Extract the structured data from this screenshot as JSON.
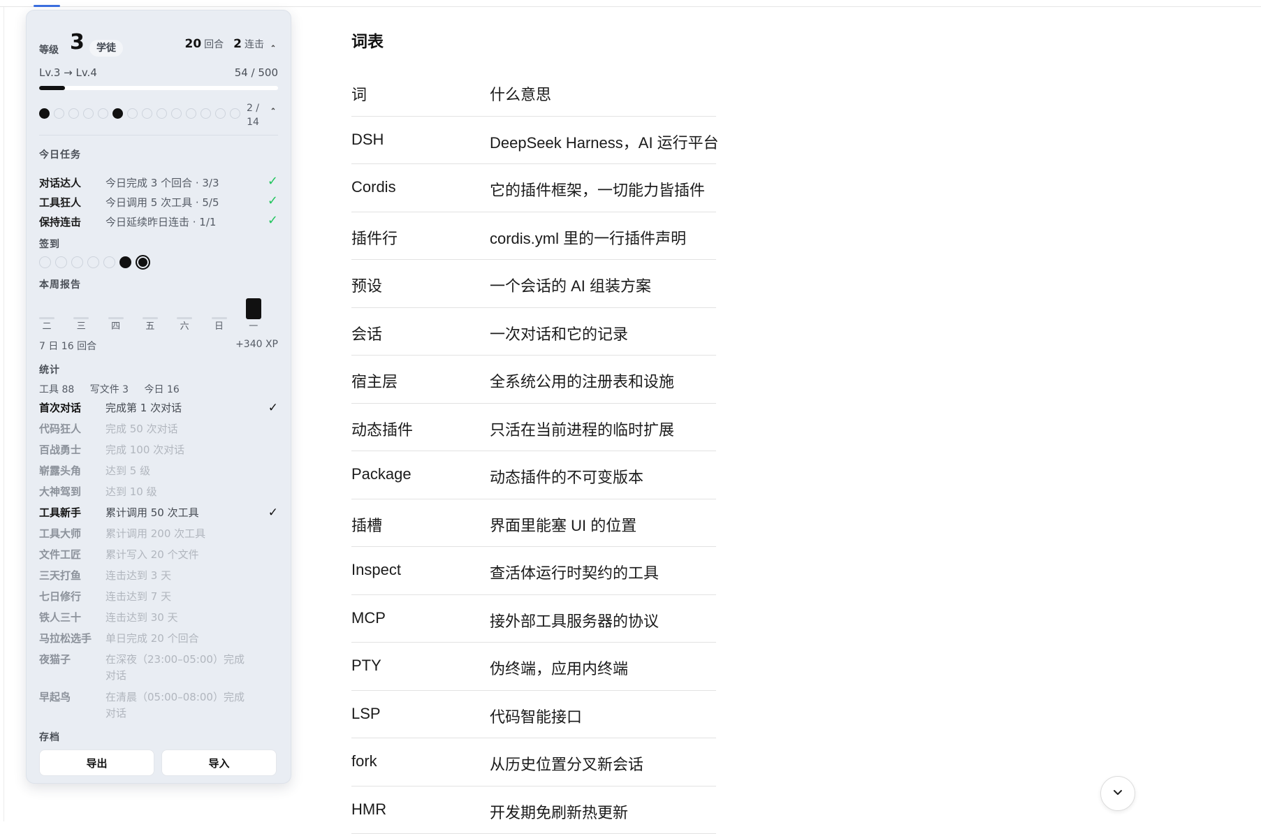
{
  "panel": {
    "level_label": "等级",
    "level": "3",
    "rank": "学徒",
    "rounds_count": "20",
    "rounds_label": "回合",
    "streak_count": "2",
    "streak_label": "连击",
    "xp_range": "Lv.3 → Lv.4",
    "xp_value": "54 / 500",
    "xp_fraction": 0.108,
    "dots_count": "2 /\n14",
    "dots_total": 14,
    "dots_on": [
      0,
      5
    ],
    "tasks_title": "今日任务",
    "tasks": [
      {
        "name": "对话达人",
        "desc": "今日完成 3 个回合 · 3/3",
        "done": true
      },
      {
        "name": "工具狂人",
        "desc": "今日调用 5 次工具 · 5/5",
        "done": true
      },
      {
        "name": "保持连击",
        "desc": "今日延续昨日连击 · 1/1",
        "done": true
      }
    ],
    "signin_title": "签到",
    "signin_states": [
      "off",
      "off",
      "off",
      "off",
      "off",
      "on",
      "today"
    ],
    "week_title": "本周报告",
    "week_days": [
      {
        "label": "二",
        "value": 0
      },
      {
        "label": "三",
        "value": 0
      },
      {
        "label": "四",
        "value": 0
      },
      {
        "label": "五",
        "value": 0
      },
      {
        "label": "六",
        "value": 0
      },
      {
        "label": "日",
        "value": 0
      },
      {
        "label": "一",
        "value": 16
      }
    ],
    "week_summary_left": "7 日 16 回合",
    "week_summary_right": "+340 XP",
    "stats_title": "统计",
    "stats": [
      "工具 88",
      "写文件 3",
      "今日 16"
    ],
    "achievements": [
      {
        "name": "首次对话",
        "desc": "完成第 1 次对话",
        "done": true
      },
      {
        "name": "代码狂人",
        "desc": "完成 50 次对话",
        "done": false
      },
      {
        "name": "百战勇士",
        "desc": "完成 100 次对话",
        "done": false
      },
      {
        "name": "崭露头角",
        "desc": "达到 5 级",
        "done": false
      },
      {
        "name": "大神驾到",
        "desc": "达到 10 级",
        "done": false
      },
      {
        "name": "工具新手",
        "desc": "累计调用 50 次工具",
        "done": true
      },
      {
        "name": "工具大师",
        "desc": "累计调用 200 次工具",
        "done": false
      },
      {
        "name": "文件工匠",
        "desc": "累计写入 20 个文件",
        "done": false
      },
      {
        "name": "三天打鱼",
        "desc": "连击达到 3 天",
        "done": false
      },
      {
        "name": "七日修行",
        "desc": "连击达到 7 天",
        "done": false
      },
      {
        "name": "铁人三十",
        "desc": "连击达到 30 天",
        "done": false
      },
      {
        "name": "马拉松选手",
        "desc": "单日完成 20 个回合",
        "done": false
      },
      {
        "name": "夜猫子",
        "desc": "在深夜（23:00–05:00）完成对话",
        "done": false
      },
      {
        "name": "早起鸟",
        "desc": "在清晨（05:00–08:00）完成对话",
        "done": false
      }
    ],
    "check_mark": "✓",
    "archive_title": "存档",
    "export_label": "导出",
    "import_label": "导入"
  },
  "glossary": {
    "title": "词表",
    "rows": [
      {
        "term": "词",
        "meaning": "什么意思"
      },
      {
        "term": "DSH",
        "meaning": "DeepSeek Harness，AI 运行平台"
      },
      {
        "term": "Cordis",
        "meaning": "它的插件框架，一切能力皆插件"
      },
      {
        "term": "插件行",
        "meaning": "cordis.yml 里的一行插件声明"
      },
      {
        "term": "预设",
        "meaning": "一个会话的 AI 组装方案"
      },
      {
        "term": "会话",
        "meaning": "一次对话和它的记录"
      },
      {
        "term": "宿主层",
        "meaning": "全系统公用的注册表和设施"
      },
      {
        "term": "动态插件",
        "meaning": "只活在当前进程的临时扩展"
      },
      {
        "term": "Package",
        "meaning": "动态插件的不可变版本"
      },
      {
        "term": "插槽",
        "meaning": "界面里能塞 UI 的位置"
      },
      {
        "term": "Inspect",
        "meaning": "查活体运行时契约的工具"
      },
      {
        "term": "MCP",
        "meaning": "接外部工具服务器的协议"
      },
      {
        "term": "PTY",
        "meaning": "伪终端，应用内终端"
      },
      {
        "term": "LSP",
        "meaning": "代码智能接口"
      },
      {
        "term": "fork",
        "meaning": "从历史位置分叉新会话"
      },
      {
        "term": "HMR",
        "meaning": "开发期免刷新热更新"
      }
    ]
  },
  "icons": {
    "collapse": "chevron-up-icon",
    "scroll_down": "chevron-down-icon"
  },
  "colors": {
    "check_green": "#22c55e",
    "tab_accent": "#3b6fe0"
  }
}
